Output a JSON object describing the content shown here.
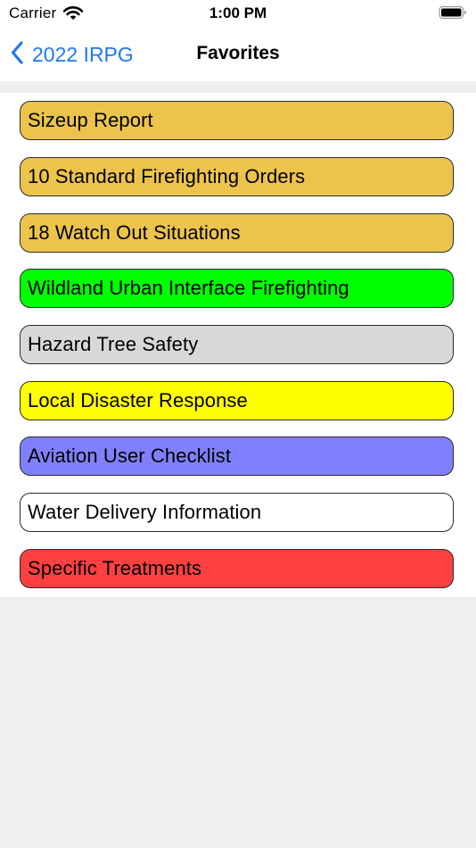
{
  "status_bar": {
    "carrier": "Carrier",
    "time": "1:00 PM",
    "wifi_icon": "wifi-icon",
    "battery_icon": "battery-icon"
  },
  "nav": {
    "back_label": "2022 IRPG",
    "back_icon": "chevron-left-icon",
    "title": "Favorites",
    "accent_color": "#1d79f2"
  },
  "favorites": [
    {
      "label": "Sizeup Report",
      "color": "#ecc44b"
    },
    {
      "label": "10 Standard Firefighting Orders",
      "color": "#ecc44b"
    },
    {
      "label": "18 Watch Out Situations",
      "color": "#ecc44b"
    },
    {
      "label": "Wildland Urban Interface Firefighting",
      "color": "#00ff00"
    },
    {
      "label": "Hazard Tree Safety",
      "color": "#d8d8d8"
    },
    {
      "label": "Local Disaster Response",
      "color": "#ffff00"
    },
    {
      "label": "Aviation User Checklist",
      "color": "#8080ff"
    },
    {
      "label": "Water Delivery Information",
      "color": "#ffffff"
    },
    {
      "label": "Specific Treatments",
      "color": "#ff4040"
    }
  ]
}
